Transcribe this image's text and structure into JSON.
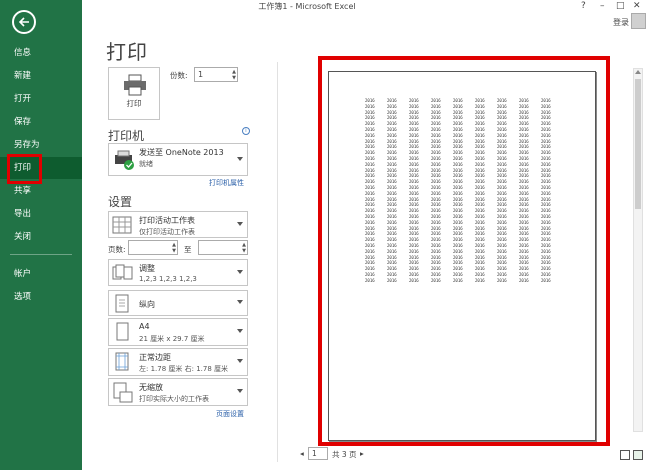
{
  "window": {
    "title": "工作簿1 - Microsoft Excel",
    "help": "?",
    "minimize": "–",
    "restore": "□",
    "close": "✕",
    "login": "登录"
  },
  "sidebar": {
    "items": [
      {
        "label": "信息"
      },
      {
        "label": "新建"
      },
      {
        "label": "打开"
      },
      {
        "label": "保存"
      },
      {
        "label": "另存为"
      },
      {
        "label": "打印"
      },
      {
        "label": "共享"
      },
      {
        "label": "导出"
      },
      {
        "label": "关闭"
      },
      {
        "label": "帐户"
      },
      {
        "label": "选项"
      }
    ],
    "active": "打印"
  },
  "print": {
    "title": "打印",
    "button_label": "打印",
    "copies_label": "份数:",
    "copies_value": "1"
  },
  "printer": {
    "section_title": "打印机",
    "name": "发送至 OneNote 2013",
    "status": "就绪",
    "properties_link": "打印机属性",
    "info_icon": "i"
  },
  "settings": {
    "section_title": "设置",
    "print_what": {
      "main": "打印活动工作表",
      "sub": "仅打印活动工作表"
    },
    "pages_label": "页数:",
    "to_label": "至",
    "collate": {
      "main": "调整",
      "sub": "1,2,3    1,2,3    1,2,3"
    },
    "orientation": {
      "main": "纵向"
    },
    "paper": {
      "main": "A4",
      "sub": "21 厘米 x 29.7 厘米"
    },
    "margins": {
      "main": "正常边距",
      "sub": "左: 1.78 厘米    右: 1.78 厘米"
    },
    "scaling": {
      "main": "无缩放",
      "sub": "打印实际大小的工作表"
    },
    "page_setup_link": "页面设置"
  },
  "preview": {
    "cell_value": "2016",
    "columns": 9,
    "rows": 32
  },
  "pager": {
    "current_page": "1",
    "total_text": "共 3 页",
    "prev": "◂",
    "next": "▸"
  }
}
